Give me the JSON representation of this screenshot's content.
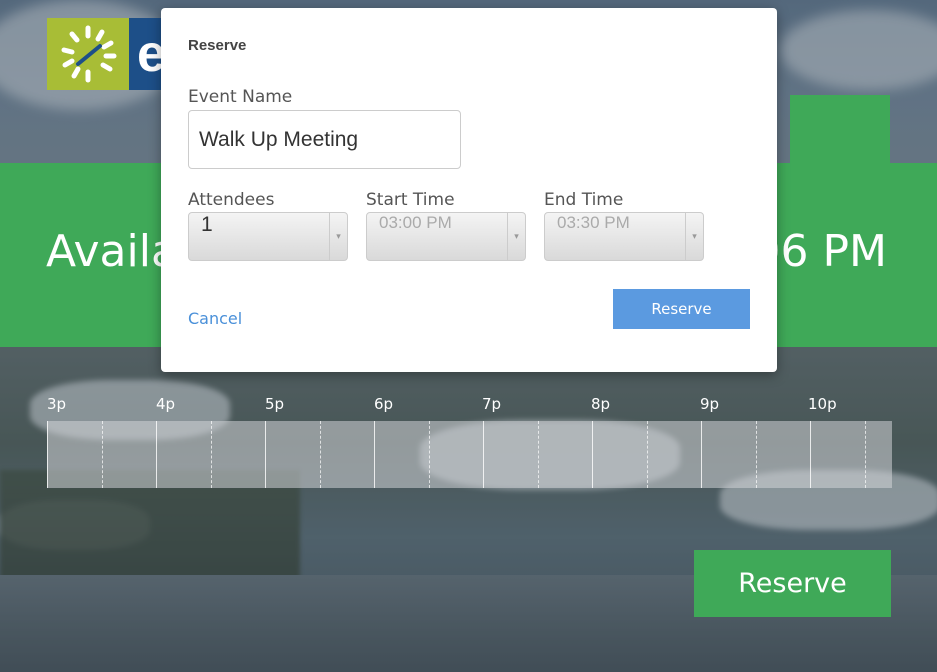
{
  "logo": {
    "letter": "e"
  },
  "banner": {
    "left_text": "Availa",
    "right_text": "06 PM"
  },
  "timeline": {
    "labels": [
      "3p",
      "4p",
      "5p",
      "6p",
      "7p",
      "8p",
      "9p",
      "10p"
    ]
  },
  "bottom_reserve_label": "Reserve",
  "modal": {
    "title": "Reserve",
    "event_name_label": "Event Name",
    "event_name_value": "Walk Up Meeting",
    "attendees_label": "Attendees",
    "attendees_value": "1",
    "start_time_label": "Start Time",
    "start_time_value": "03:00 PM",
    "end_time_label": "End Time",
    "end_time_value": "03:30 PM",
    "cancel_label": "Cancel",
    "reserve_label": "Reserve"
  },
  "colors": {
    "accent_green": "#3fa958",
    "button_blue": "#5b9ae0",
    "logo_green": "#a8bd36",
    "logo_blue": "#1d4f88"
  }
}
